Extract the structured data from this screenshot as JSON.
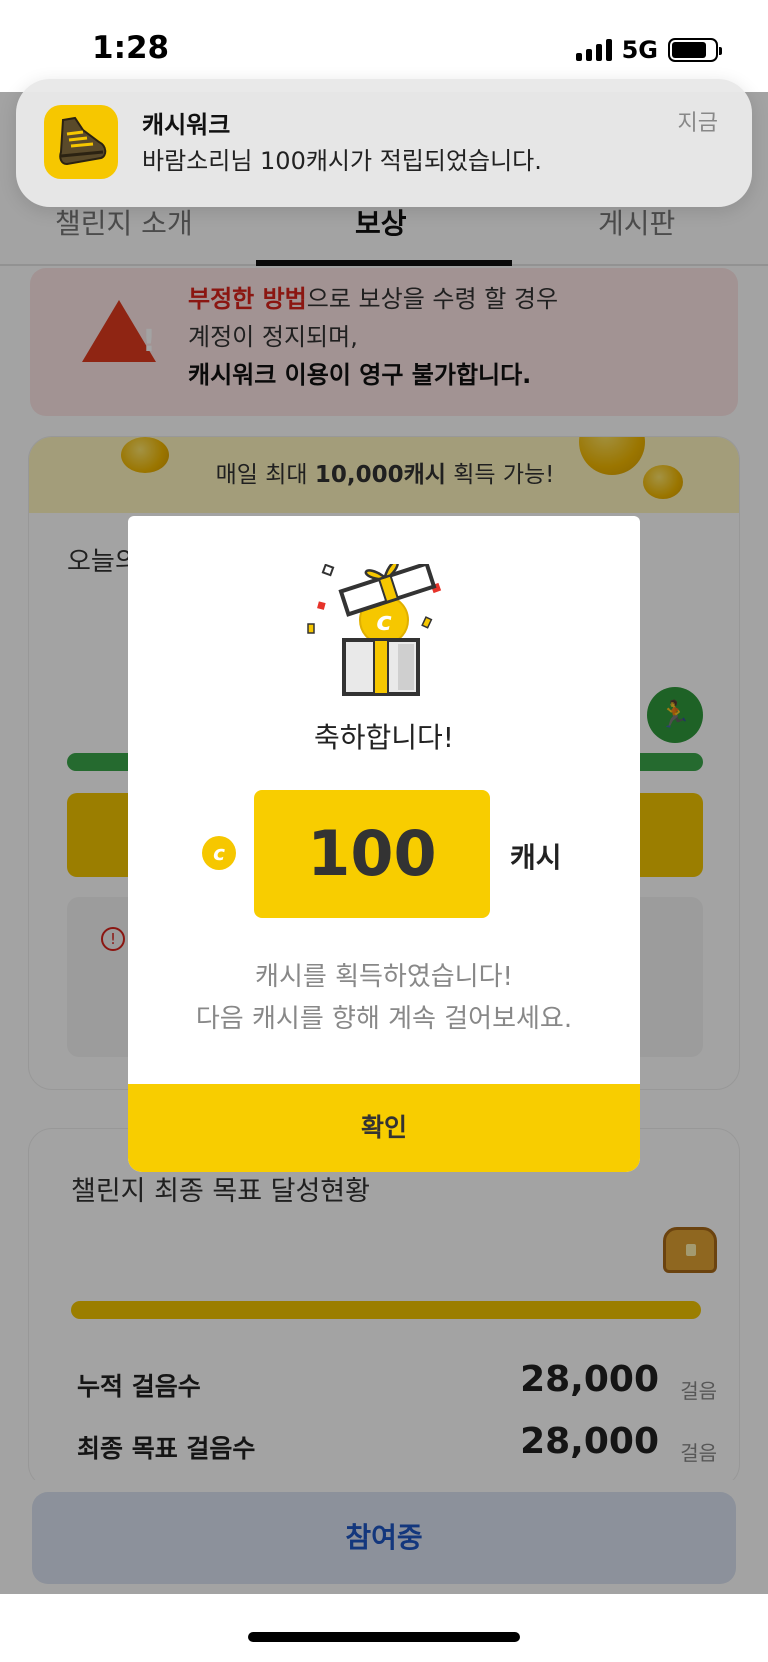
{
  "status_bar": {
    "time": "1:28",
    "network": "5G",
    "battery_level": 0.8
  },
  "notification": {
    "app_name": "캐시워크",
    "message": "바람소리님 100캐시가 적립되었습니다.",
    "time": "지금",
    "icon": "sneaker-icon"
  },
  "tabs": [
    {
      "label": "챌린지 소개",
      "active": false
    },
    {
      "label": "보상",
      "active": true
    },
    {
      "label": "게시판",
      "active": false
    }
  ],
  "warning": {
    "icon": "warning-triangle-icon",
    "emph": "부정한 방법",
    "line1_rest": "으로 보상을 수령 할 경우",
    "line2": "계정이 정지되며,",
    "line3": "캐시워크 이용이 영구 불가합니다."
  },
  "reward_card": {
    "banner_prefix": "매일 최대 ",
    "banner_bold": "10,000캐시",
    "banner_suffix": " 획득 가능!",
    "today_label": "오늘의"
  },
  "goal_card": {
    "title": "챌린지 최종 목표 달성현황",
    "stats": [
      {
        "label": "누적 걸음수",
        "value": "28,000",
        "unit": "걸음"
      },
      {
        "label": "최종 목표 걸음수",
        "value": "28,000",
        "unit": "걸음"
      }
    ]
  },
  "bottom_button": {
    "label": "참여중"
  },
  "modal": {
    "title": "축하합니다!",
    "coin_symbol": "c",
    "amount": "100",
    "unit": "캐시",
    "desc_line1": "캐시를 획득하였습니다!",
    "desc_line2": "다음 캐시를 향해 계속 걸어보세요.",
    "confirm_label": "확인"
  },
  "colors": {
    "brand_yellow": "#f8cd00",
    "warning_red": "#d9231c",
    "progress_green": "#3aa74a",
    "join_blue": "#1f56c4"
  }
}
